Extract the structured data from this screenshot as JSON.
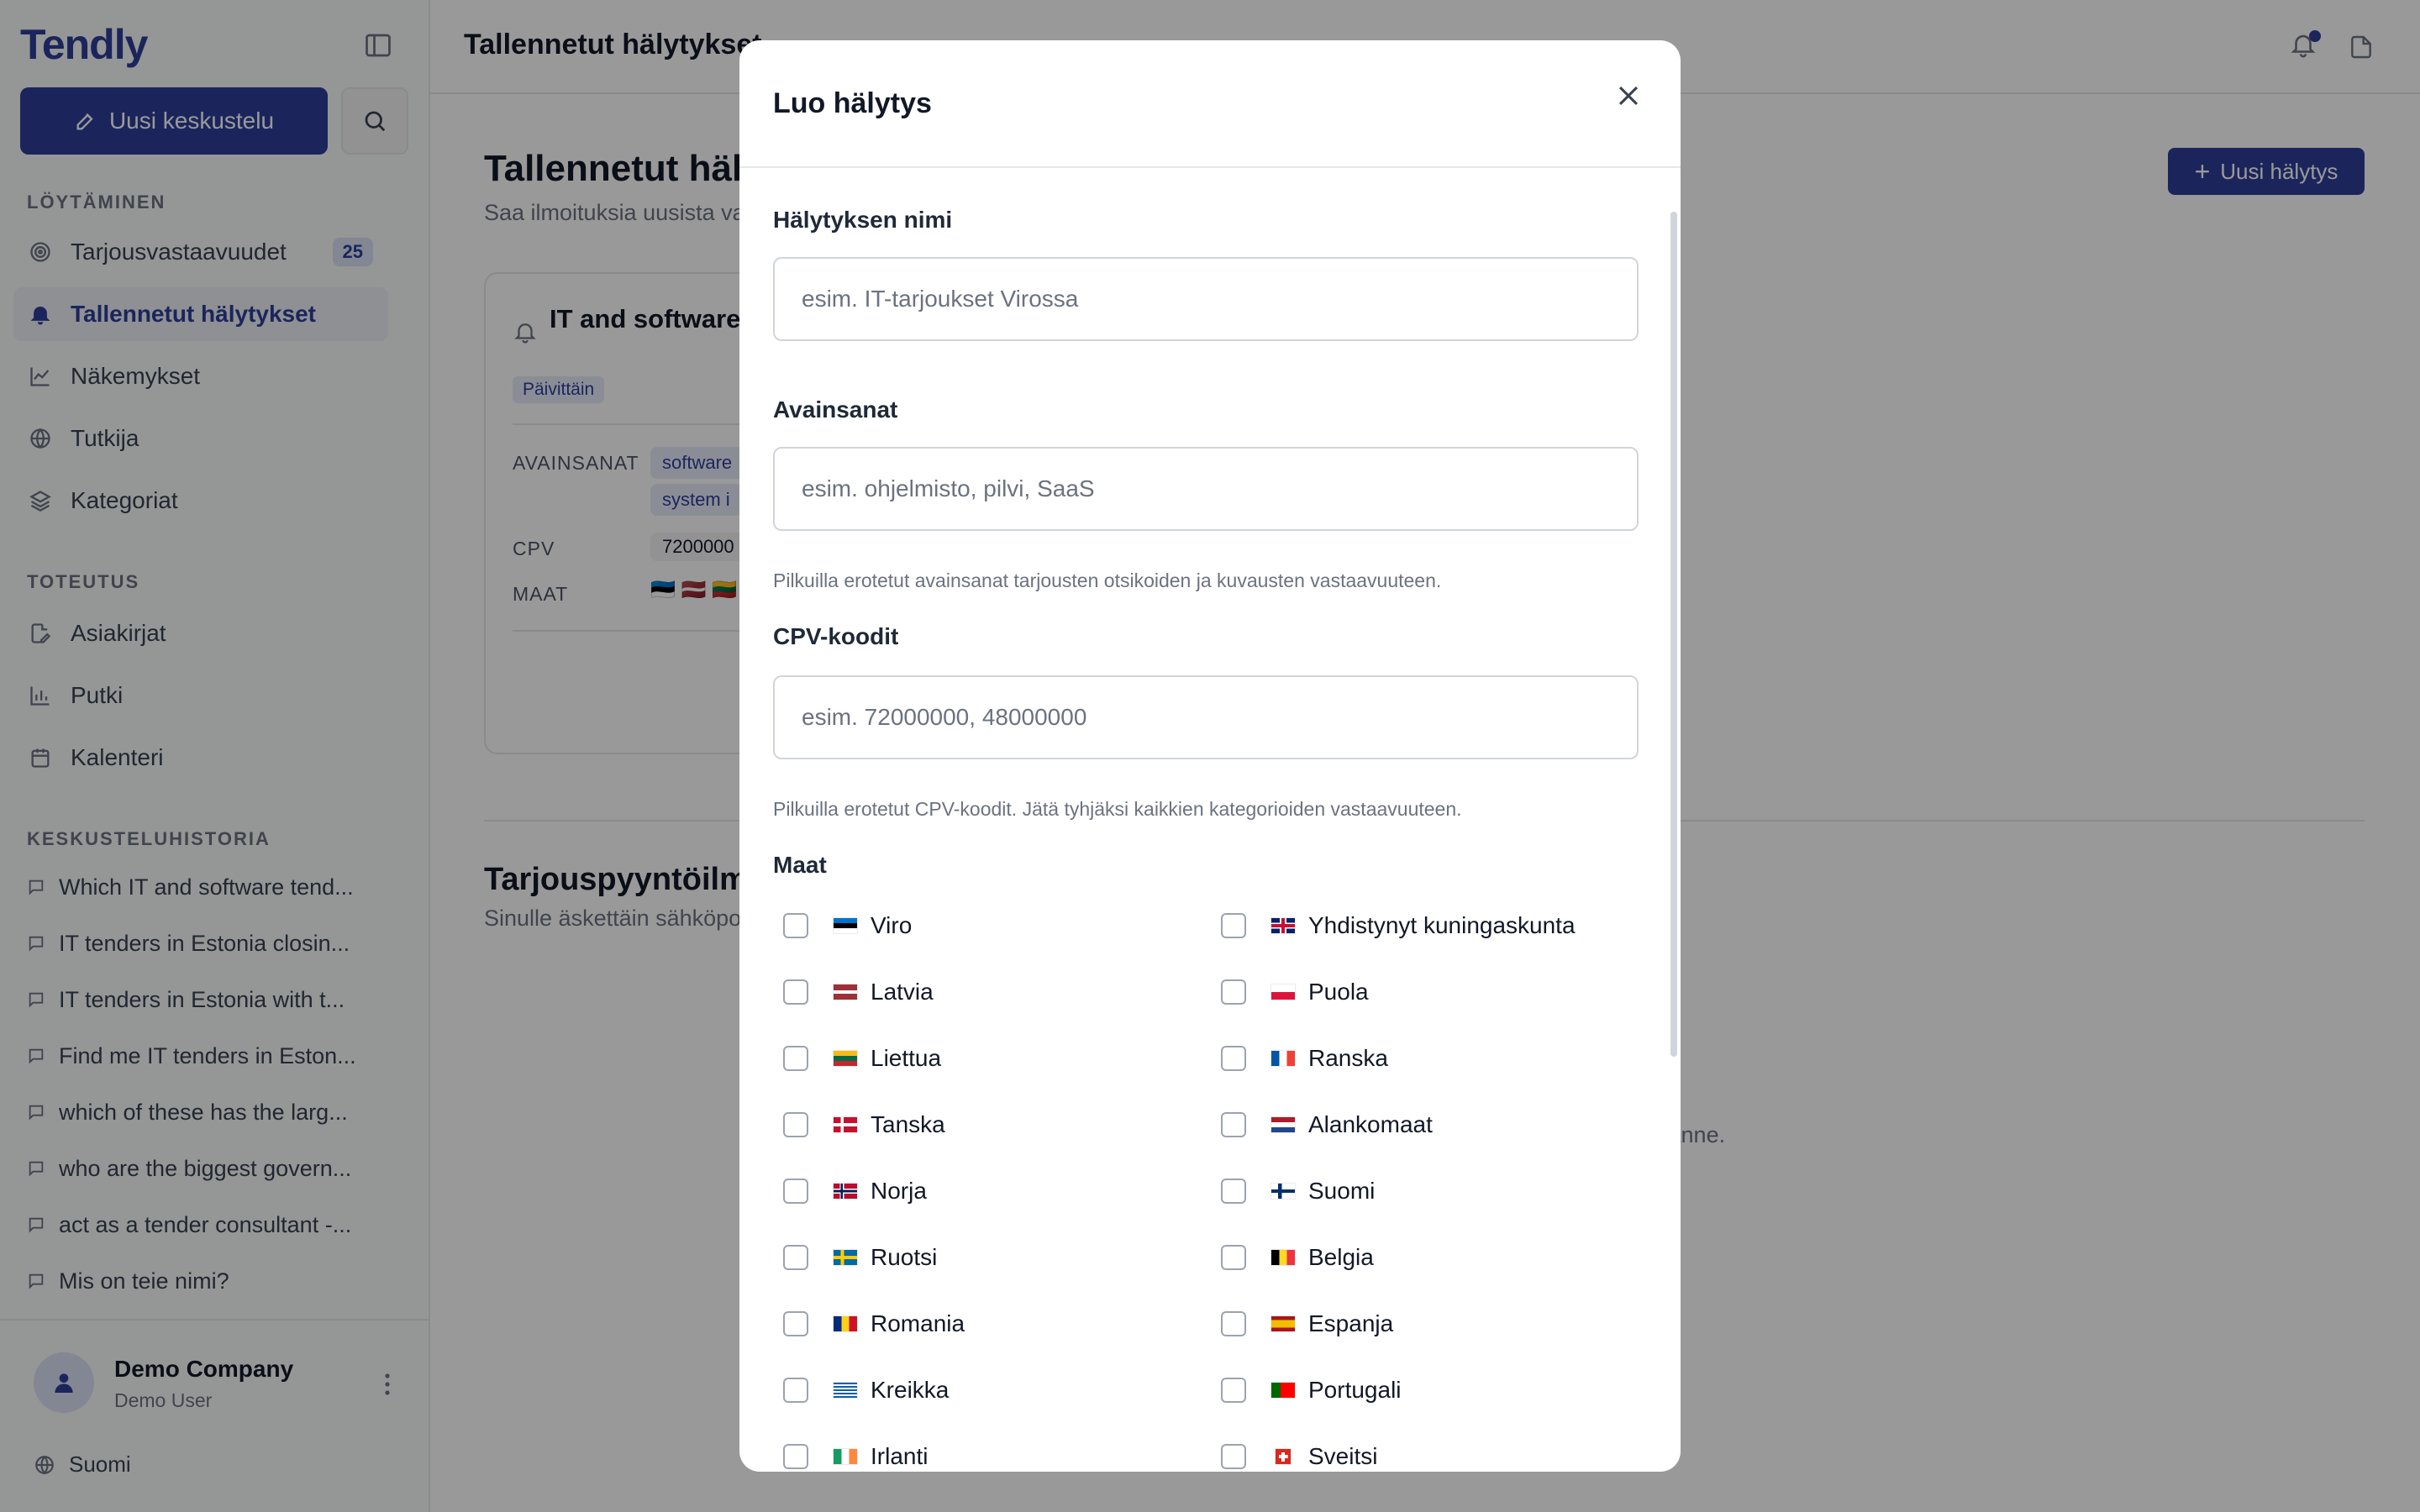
{
  "sidebar": {
    "brand": "Tendly",
    "new_chat_label": "Uusi keskustelu",
    "section_discovery": "LÖYTÄMINEN",
    "discovery_items": [
      {
        "label": "Tarjousvastaavuudet",
        "badge": "25",
        "icon": "target-icon"
      },
      {
        "label": "Tallennetut hälytykset",
        "icon": "bell-icon",
        "active": true
      },
      {
        "label": "Näkemykset",
        "icon": "chart-line-icon"
      },
      {
        "label": "Tutkija",
        "icon": "globe-icon"
      },
      {
        "label": "Kategoriat",
        "icon": "layers-icon"
      }
    ],
    "section_execution": "TOTEUTUS",
    "execution_items": [
      {
        "label": "Asiakirjat",
        "icon": "document-edit-icon"
      },
      {
        "label": "Putki",
        "icon": "bar-chart-icon"
      },
      {
        "label": "Kalenteri",
        "icon": "calendar-icon"
      }
    ],
    "section_history": "KESKUSTELUHISTORIA",
    "history": [
      "Which IT and software tend...",
      "IT tenders in Estonia closin...",
      "IT tenders in Estonia with t...",
      "Find me IT tenders in Eston...",
      "which of these has the larg...",
      "who are the biggest govern...",
      "act as a tender consultant -...",
      "Mis on teie nimi?"
    ],
    "company": "Demo Company",
    "user": "Demo User",
    "language": "Suomi"
  },
  "topbar": {
    "title": "Tallennetut hälytykset"
  },
  "main": {
    "page_title": "Tallennetut hälyt",
    "page_subtitle": "Saa ilmoituksia uusista va",
    "new_alert_label": "Uusi hälytys",
    "card": {
      "title": "IT and software Baltics",
      "frequency": "Päivittäin",
      "keywords_label": "AVAINSANAT",
      "keywords": [
        "software",
        "system i"
      ],
      "cpv_label": "CPV",
      "cpv_value": "7200000",
      "countries_label": "MAAT",
      "flags": "🇪🇪 🇱🇻 🇱🇹"
    },
    "section2_title": "Tarjouspyyntöilm",
    "section2_subtitle": "Sinulle äskettäin sähköpo",
    "empty_text": "styvät tänne."
  },
  "modal": {
    "title": "Luo hälytys",
    "name_label": "Hälytyksen nimi",
    "name_placeholder": "esim. IT-tarjoukset Virossa",
    "keywords_label": "Avainsanat",
    "keywords_placeholder": "esim. ohjelmisto, pilvi, SaaS",
    "keywords_hint": "Pilkuilla erotetut avainsanat tarjousten otsikoiden ja kuvausten vastaavuuteen.",
    "cpv_label": "CPV-koodit",
    "cpv_placeholder": "esim. 72000000, 48000000",
    "cpv_hint": "Pilkuilla erotetut CPV-koodit. Jätä tyhjäksi kaikkien kategorioiden vastaavuuteen.",
    "countries_label": "Maat",
    "countries_left": [
      {
        "name": "Viro",
        "flag": "ee",
        "checked": false
      },
      {
        "name": "Latvia",
        "flag": "lv",
        "checked": false
      },
      {
        "name": "Liettua",
        "flag": "lt",
        "checked": false
      },
      {
        "name": "Tanska",
        "flag": "dk",
        "checked": false
      },
      {
        "name": "Norja",
        "flag": "no",
        "checked": false
      },
      {
        "name": "Ruotsi",
        "flag": "se",
        "checked": false
      },
      {
        "name": "Romania",
        "flag": "ro",
        "checked": false
      },
      {
        "name": "Kreikka",
        "flag": "gr",
        "checked": false
      },
      {
        "name": "Irlanti",
        "flag": "ie",
        "checked": false
      }
    ],
    "countries_right": [
      {
        "name": "Yhdistynyt kuningaskunta",
        "flag": "gb",
        "checked": false
      },
      {
        "name": "Puola",
        "flag": "pl",
        "checked": false
      },
      {
        "name": "Ranska",
        "flag": "fr",
        "checked": false
      },
      {
        "name": "Alankomaat",
        "flag": "nl",
        "checked": false
      },
      {
        "name": "Suomi",
        "flag": "fi",
        "checked": false
      },
      {
        "name": "Belgia",
        "flag": "be",
        "checked": false
      },
      {
        "name": "Espanja",
        "flag": "es",
        "checked": false
      },
      {
        "name": "Portugali",
        "flag": "pt",
        "checked": false
      },
      {
        "name": "Sveitsi",
        "flag": "ch",
        "checked": false
      }
    ]
  },
  "colors": {
    "accent": "#2e3f99",
    "overlay": "rgba(0,0,0,0.4)"
  }
}
